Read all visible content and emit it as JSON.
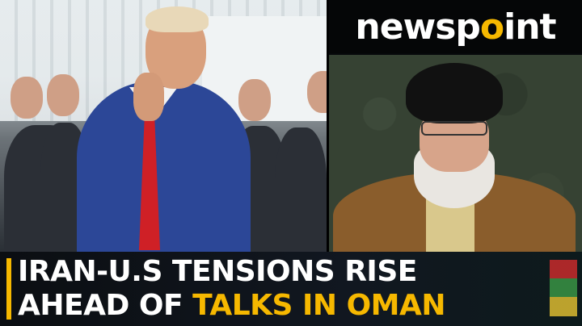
{
  "logo": {
    "part1": "newsp",
    "dot": "o",
    "part2": "int"
  },
  "headline": {
    "line1_white_a": "IRAN-U.S TENSIONS RISE",
    "line2_white_a": "AHEAD OF ",
    "line2_yellow": "TALKS IN OMAN"
  },
  "colors": {
    "accent": "#f6b800",
    "headline_text": "#ffffff"
  }
}
